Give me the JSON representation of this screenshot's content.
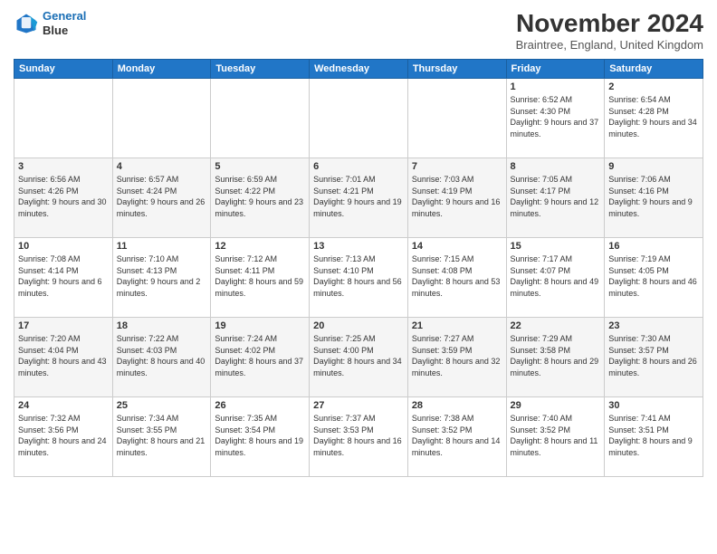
{
  "header": {
    "logo_line1": "General",
    "logo_line2": "Blue",
    "month_title": "November 2024",
    "location": "Braintree, England, United Kingdom"
  },
  "weekdays": [
    "Sunday",
    "Monday",
    "Tuesday",
    "Wednesday",
    "Thursday",
    "Friday",
    "Saturday"
  ],
  "weeks": [
    [
      {
        "day": "",
        "info": ""
      },
      {
        "day": "",
        "info": ""
      },
      {
        "day": "",
        "info": ""
      },
      {
        "day": "",
        "info": ""
      },
      {
        "day": "",
        "info": ""
      },
      {
        "day": "1",
        "info": "Sunrise: 6:52 AM\nSunset: 4:30 PM\nDaylight: 9 hours and 37 minutes."
      },
      {
        "day": "2",
        "info": "Sunrise: 6:54 AM\nSunset: 4:28 PM\nDaylight: 9 hours and 34 minutes."
      }
    ],
    [
      {
        "day": "3",
        "info": "Sunrise: 6:56 AM\nSunset: 4:26 PM\nDaylight: 9 hours and 30 minutes."
      },
      {
        "day": "4",
        "info": "Sunrise: 6:57 AM\nSunset: 4:24 PM\nDaylight: 9 hours and 26 minutes."
      },
      {
        "day": "5",
        "info": "Sunrise: 6:59 AM\nSunset: 4:22 PM\nDaylight: 9 hours and 23 minutes."
      },
      {
        "day": "6",
        "info": "Sunrise: 7:01 AM\nSunset: 4:21 PM\nDaylight: 9 hours and 19 minutes."
      },
      {
        "day": "7",
        "info": "Sunrise: 7:03 AM\nSunset: 4:19 PM\nDaylight: 9 hours and 16 minutes."
      },
      {
        "day": "8",
        "info": "Sunrise: 7:05 AM\nSunset: 4:17 PM\nDaylight: 9 hours and 12 minutes."
      },
      {
        "day": "9",
        "info": "Sunrise: 7:06 AM\nSunset: 4:16 PM\nDaylight: 9 hours and 9 minutes."
      }
    ],
    [
      {
        "day": "10",
        "info": "Sunrise: 7:08 AM\nSunset: 4:14 PM\nDaylight: 9 hours and 6 minutes."
      },
      {
        "day": "11",
        "info": "Sunrise: 7:10 AM\nSunset: 4:13 PM\nDaylight: 9 hours and 2 minutes."
      },
      {
        "day": "12",
        "info": "Sunrise: 7:12 AM\nSunset: 4:11 PM\nDaylight: 8 hours and 59 minutes."
      },
      {
        "day": "13",
        "info": "Sunrise: 7:13 AM\nSunset: 4:10 PM\nDaylight: 8 hours and 56 minutes."
      },
      {
        "day": "14",
        "info": "Sunrise: 7:15 AM\nSunset: 4:08 PM\nDaylight: 8 hours and 53 minutes."
      },
      {
        "day": "15",
        "info": "Sunrise: 7:17 AM\nSunset: 4:07 PM\nDaylight: 8 hours and 49 minutes."
      },
      {
        "day": "16",
        "info": "Sunrise: 7:19 AM\nSunset: 4:05 PM\nDaylight: 8 hours and 46 minutes."
      }
    ],
    [
      {
        "day": "17",
        "info": "Sunrise: 7:20 AM\nSunset: 4:04 PM\nDaylight: 8 hours and 43 minutes."
      },
      {
        "day": "18",
        "info": "Sunrise: 7:22 AM\nSunset: 4:03 PM\nDaylight: 8 hours and 40 minutes."
      },
      {
        "day": "19",
        "info": "Sunrise: 7:24 AM\nSunset: 4:02 PM\nDaylight: 8 hours and 37 minutes."
      },
      {
        "day": "20",
        "info": "Sunrise: 7:25 AM\nSunset: 4:00 PM\nDaylight: 8 hours and 34 minutes."
      },
      {
        "day": "21",
        "info": "Sunrise: 7:27 AM\nSunset: 3:59 PM\nDaylight: 8 hours and 32 minutes."
      },
      {
        "day": "22",
        "info": "Sunrise: 7:29 AM\nSunset: 3:58 PM\nDaylight: 8 hours and 29 minutes."
      },
      {
        "day": "23",
        "info": "Sunrise: 7:30 AM\nSunset: 3:57 PM\nDaylight: 8 hours and 26 minutes."
      }
    ],
    [
      {
        "day": "24",
        "info": "Sunrise: 7:32 AM\nSunset: 3:56 PM\nDaylight: 8 hours and 24 minutes."
      },
      {
        "day": "25",
        "info": "Sunrise: 7:34 AM\nSunset: 3:55 PM\nDaylight: 8 hours and 21 minutes."
      },
      {
        "day": "26",
        "info": "Sunrise: 7:35 AM\nSunset: 3:54 PM\nDaylight: 8 hours and 19 minutes."
      },
      {
        "day": "27",
        "info": "Sunrise: 7:37 AM\nSunset: 3:53 PM\nDaylight: 8 hours and 16 minutes."
      },
      {
        "day": "28",
        "info": "Sunrise: 7:38 AM\nSunset: 3:52 PM\nDaylight: 8 hours and 14 minutes."
      },
      {
        "day": "29",
        "info": "Sunrise: 7:40 AM\nSunset: 3:52 PM\nDaylight: 8 hours and 11 minutes."
      },
      {
        "day": "30",
        "info": "Sunrise: 7:41 AM\nSunset: 3:51 PM\nDaylight: 8 hours and 9 minutes."
      }
    ]
  ]
}
